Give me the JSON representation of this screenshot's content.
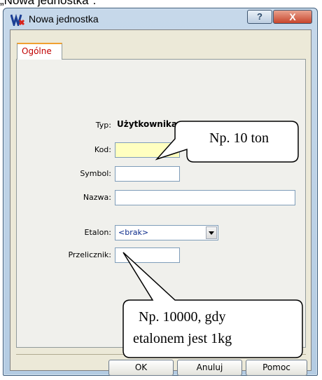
{
  "caption": "„Nowa jednostka\".",
  "window": {
    "title": "Nowa jednostka",
    "help_label": "?",
    "close_label": "X"
  },
  "tabs": [
    {
      "label": "Ogólne"
    }
  ],
  "form": {
    "typ_label": "Typ:",
    "typ_value": "Użytkownika",
    "kod_label": "Kod:",
    "kod_value": "",
    "symbol_label": "Symbol:",
    "symbol_value": "",
    "nazwa_label": "Nazwa:",
    "nazwa_value": "",
    "etalon_label": "Etalon:",
    "etalon_value": "<brak>",
    "przelicznik_label": "Przelicznik:",
    "przelicznik_value": ""
  },
  "buttons": {
    "ok": "OK",
    "anuluj": "Anuluj",
    "pomoc": "Pomoc"
  },
  "callouts": {
    "symbol_note": "Np. 10 ton",
    "przelicznik_note_line1": "Np. 10000, gdy",
    "przelicznik_note_line2": "etalonem jest 1kg"
  },
  "colors": {
    "kod_field_bg": "#ffffc0",
    "tab_label": "#c00000",
    "close_button": "#c8452c"
  }
}
